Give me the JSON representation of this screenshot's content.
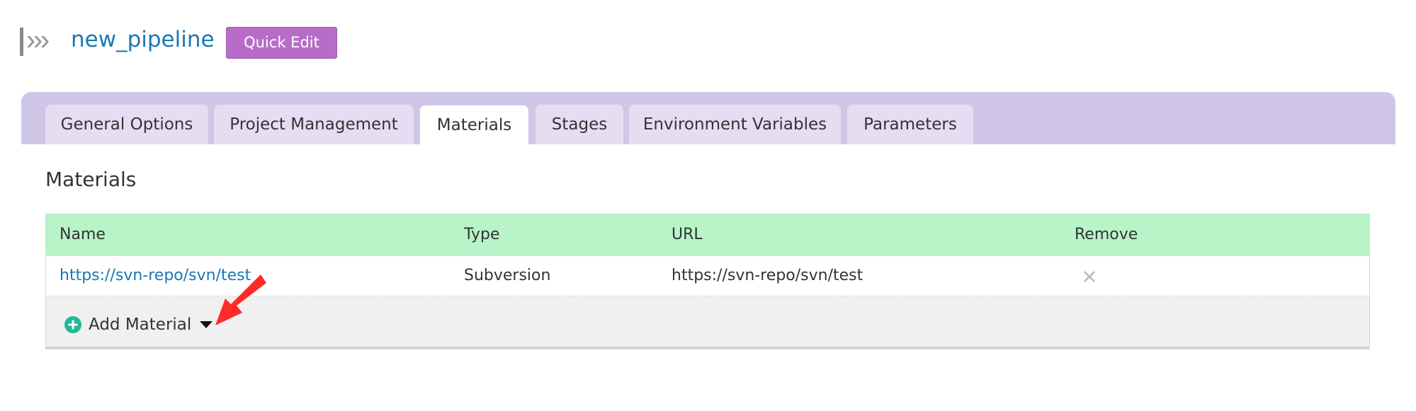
{
  "header": {
    "pipeline_name": "new_pipeline",
    "quick_edit_label": "Quick Edit",
    "pipeline_icon": "pipeline-chevrons-icon"
  },
  "tabs": [
    {
      "label": "General Options",
      "active": false
    },
    {
      "label": "Project Management",
      "active": false
    },
    {
      "label": "Materials",
      "active": true
    },
    {
      "label": "Stages",
      "active": false
    },
    {
      "label": "Environment Variables",
      "active": false
    },
    {
      "label": "Parameters",
      "active": false
    }
  ],
  "materials": {
    "title": "Materials",
    "columns": [
      "Name",
      "Type",
      "URL",
      "Remove"
    ],
    "rows": [
      {
        "name": "https://svn-repo/svn/test",
        "type": "Subversion",
        "url": "https://svn-repo/svn/test",
        "remove_icon": "close-x-icon"
      }
    ],
    "add_material_label": "Add Material",
    "add_icon": "plus-circle-icon",
    "dropdown_icon": "caret-down-icon"
  },
  "colors": {
    "title_link": "#1a78b4",
    "quick_edit_bg": "#b76dc8",
    "tab_band": "#d0c6e8",
    "tab_inactive": "#e5def3",
    "table_header": "#b8f4c8",
    "add_icon": "#1fb89a",
    "annotation_arrow": "#ff2a2a"
  }
}
